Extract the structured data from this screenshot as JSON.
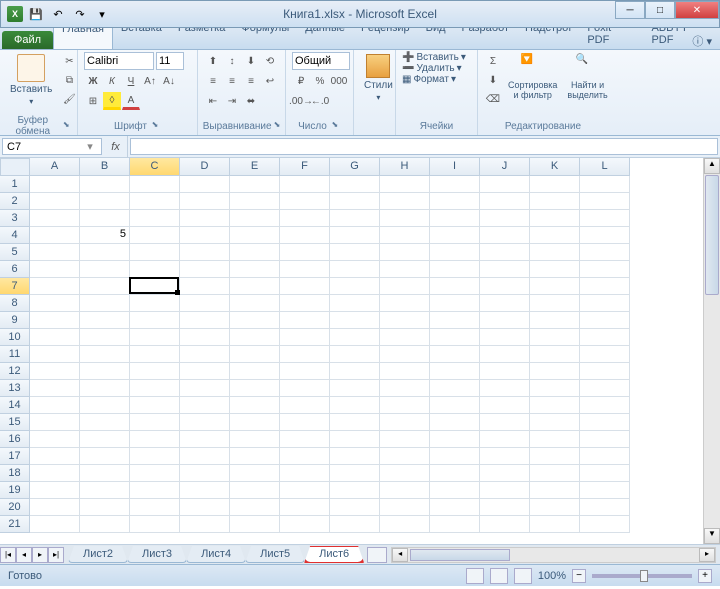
{
  "title": "Книга1.xlsx - Microsoft Excel",
  "file_tab": "Файл",
  "tabs": [
    "Главная",
    "Вставка",
    "Разметка",
    "Формулы",
    "Данные",
    "Рецензир",
    "Вид",
    "Разработ",
    "Надстрої",
    "Foxit PDF",
    "ABBYY PDF"
  ],
  "active_tab": 0,
  "ribbon": {
    "clipboard": {
      "label": "Буфер обмена",
      "paste": "Вставить"
    },
    "font": {
      "label": "Шрифт",
      "family": "Calibri",
      "size": "11"
    },
    "alignment": {
      "label": "Выравнивание"
    },
    "number": {
      "label": "Число",
      "format": "Общий"
    },
    "styles": {
      "label": "",
      "btn": "Стили"
    },
    "cells": {
      "label": "Ячейки",
      "insert": "Вставить",
      "delete": "Удалить",
      "format": "Формат"
    },
    "editing": {
      "label": "Редактирование",
      "sort": "Сортировка и фильтр",
      "find": "Найти и выделить"
    }
  },
  "namebox": "C7",
  "fx": "fx",
  "columns": [
    "A",
    "B",
    "C",
    "D",
    "E",
    "F",
    "G",
    "H",
    "I",
    "J",
    "K",
    "L"
  ],
  "row_count": 21,
  "active_col": "C",
  "active_row": 7,
  "cell_data": {
    "B4": "5"
  },
  "sheets": [
    "Лист2",
    "Лист3",
    "Лист4",
    "Лист5",
    "Лист6"
  ],
  "active_sheet": 4,
  "highlighted_sheet": 4,
  "status": "Готово",
  "zoom": "100%"
}
